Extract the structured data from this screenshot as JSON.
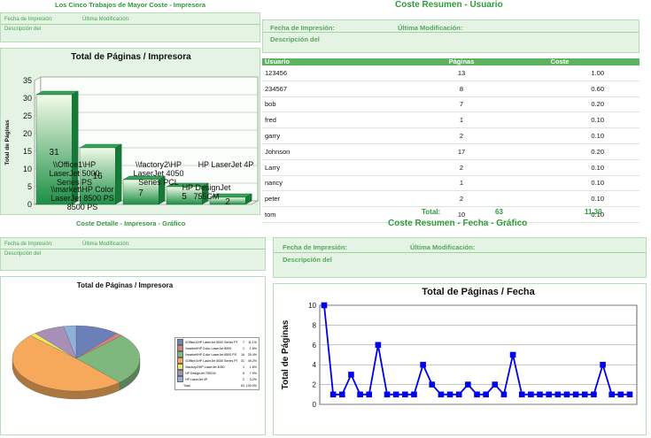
{
  "top_left": {
    "title": "Los Cinco Trabajos de Mayor Coste - Impresora",
    "print_date_label": "Fecha de Impresión:",
    "last_modified_label": "Última Modificación:",
    "description_label": "Descripción del",
    "caption": "Coste Detalle - Impresora - Gráfico"
  },
  "top_right": {
    "title": "Coste Resumen - Usuario",
    "print_date_label": "Fecha de Impresión:",
    "last_modified_label": "Última Modificación:",
    "description_label": "Descripción del",
    "table": {
      "headers": [
        "Usuario",
        "Páginas",
        "Coste"
      ],
      "rows": [
        [
          "123456",
          "13",
          "1.00"
        ],
        [
          "234567",
          "8",
          "0.60"
        ],
        [
          "bob",
          "7",
          "0.20"
        ],
        [
          "fred",
          "1",
          "0.10"
        ],
        [
          "garry",
          "2",
          "0.10"
        ],
        [
          "Johnson",
          "17",
          "0.20"
        ],
        [
          "Larry",
          "2",
          "0.10"
        ],
        [
          "nancy",
          "1",
          "0.10"
        ],
        [
          "peter",
          "2",
          "0.10"
        ],
        [
          "tom",
          "10",
          "0.10"
        ]
      ],
      "total_label": "Total:",
      "total_pages": "63",
      "total_cost": "11.30"
    }
  },
  "bottom_left": {
    "print_date_label": "Fecha de Impresión:",
    "last_modified_label": "Última Modificación:",
    "description_label": "Descripción del"
  },
  "bottom_right": {
    "title": "Coste Resumen - Fecha - Gráfico",
    "print_date_label": "Fecha de Impresión:",
    "last_modified_label": "Última Modificación:",
    "description_label": "Descripción del"
  },
  "colors": {
    "accent_green": "#2f9a3a",
    "panel_bg": "#e4f3e4",
    "line_blue": "#0000ee"
  },
  "chart_data": [
    {
      "type": "bar",
      "title": "Total de Páginas / Impresora",
      "ylabel": "Total de Páginas",
      "categories": [
        "\\\\Office1\\HP LaserJet 5000 Series PS",
        "\\\\market\\HP Color LaserJet 8500 PS 8500 PS",
        "\\\\factory2\\HP LaserJet 4050 Series PCL",
        "HP DesignJet 755CM",
        "HP LaserJet 4P"
      ],
      "category_lines": [
        [
          "\\\\Office1\\HP",
          "LaserJet 5000",
          "Series PS"
        ],
        [
          "\\\\market\\HP Color",
          "LaserJet 8500 PS",
          "8500 PS"
        ],
        [
          "\\\\factory2\\HP",
          "LaserJet 4050",
          "Series PCL"
        ],
        [
          "HP DesignJet",
          "755CM"
        ],
        [
          "HP LaserJet 4P"
        ]
      ],
      "values": [
        31,
        16,
        7,
        5,
        2
      ],
      "ylim": [
        0,
        35
      ],
      "yticks": [
        "0",
        "5",
        "10",
        "15",
        "20",
        "25",
        "30",
        "35"
      ],
      "grid": true
    },
    {
      "type": "pie",
      "title": "Total de Páginas / Impresora",
      "slices": [
        {
          "label": "\\\\Office1\\HP LaserJet 5000 Series PS",
          "value": 7,
          "pct": "11.1%",
          "color": "#6b7fb8"
        },
        {
          "label": "\\\\market\\HP Color LaserJet 8500",
          "value": 1,
          "pct": "1.6%",
          "color": "#d9807a"
        },
        {
          "label": "\\\\market\\HP Color LaserJet 8500 PS 8500 PS",
          "value": 16,
          "pct": "25.4%",
          "color": "#7fb87f"
        },
        {
          "label": "\\\\Office1\\HP LaserJet 5000 Series PS",
          "value": 31,
          "pct": "49.2%",
          "color": "#f6a95a"
        },
        {
          "label": "\\\\factory2\\HP LaserJet 4050",
          "value": 1,
          "pct": "1.6%",
          "color": "#f2ea5c"
        },
        {
          "label": "HP DesignJet 755CM",
          "value": 5,
          "pct": "7.9%",
          "color": "#a88fb8"
        },
        {
          "label": "HP LaserJet 4P",
          "value": 2,
          "pct": "3.2%",
          "color": "#8fb0d8"
        }
      ],
      "total_label": "Total",
      "total_value": "63",
      "total_pct": "100.0%"
    },
    {
      "type": "line",
      "title": "Total de Páginas / Fecha",
      "ylabel": "Total de Páginas",
      "values": [
        10,
        1,
        1,
        3,
        1,
        1,
        6,
        1,
        1,
        1,
        1,
        4,
        2,
        1,
        1,
        1,
        2,
        1,
        1,
        2,
        1,
        5,
        1,
        1,
        1,
        1,
        1,
        1,
        1,
        1,
        1,
        4,
        1,
        1,
        1
      ],
      "ylim": [
        0,
        10
      ],
      "yticks": [
        "0",
        "2",
        "4",
        "6",
        "8",
        "10"
      ],
      "grid": true
    }
  ]
}
